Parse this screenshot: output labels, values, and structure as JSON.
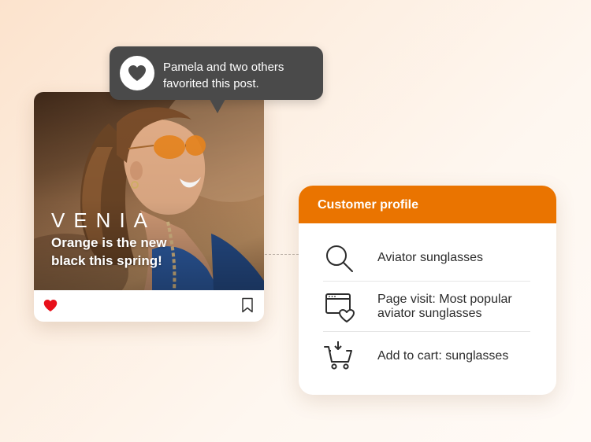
{
  "post": {
    "brand": "VENIA",
    "headline": "Orange is the new black this spring!",
    "liked": true
  },
  "tooltip": {
    "text": "Pamela and two others favorited this post."
  },
  "profile": {
    "title": "Customer profile",
    "items": [
      {
        "icon": "search-icon",
        "label": "Aviator sunglasses"
      },
      {
        "icon": "browser-heart-icon",
        "label": "Page visit: Most popular aviator sunglasses"
      },
      {
        "icon": "cart-add-icon",
        "label": "Add to cart: sunglasses"
      }
    ]
  },
  "colors": {
    "accent": "#ea7400",
    "tooltip_bg": "#4a4a4a",
    "like_red": "#e8101a"
  }
}
